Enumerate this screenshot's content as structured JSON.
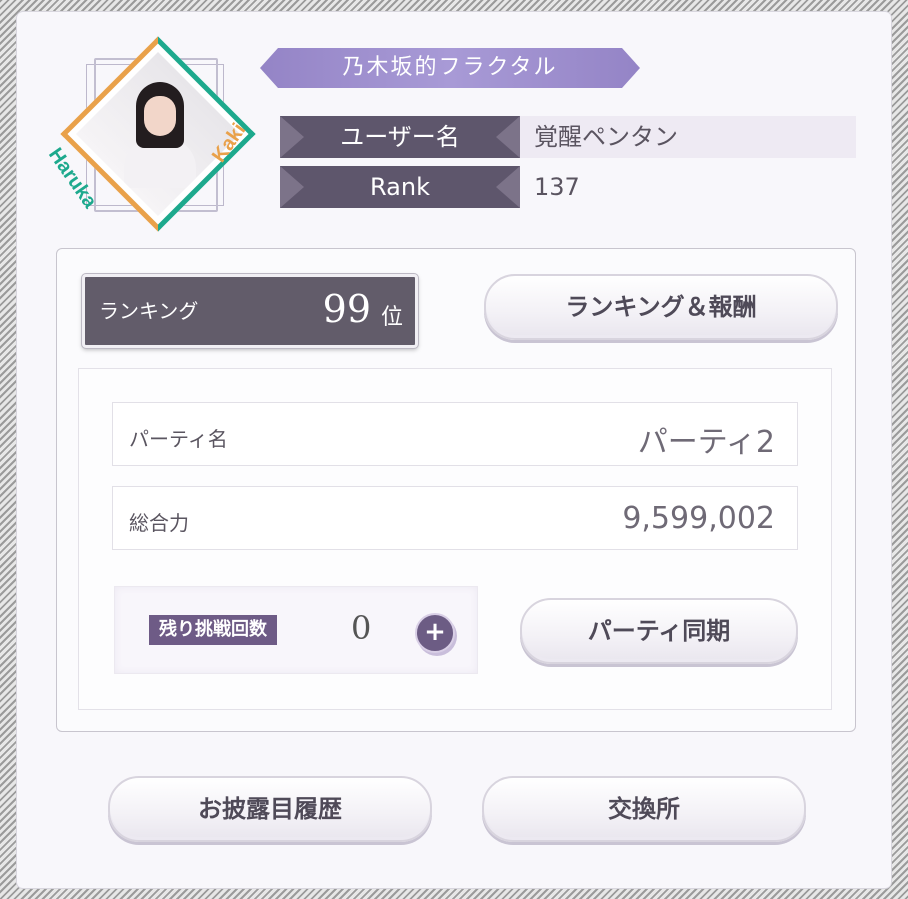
{
  "title_banner": "乃木坂的フラクタル",
  "portrait": {
    "name_first": "Haruka",
    "name_last": "Kaki",
    "colors": {
      "first": "#1da98d",
      "last": "#e9a14a"
    }
  },
  "profile": {
    "username_label": "ユーザー名",
    "username_value": "覚醒ペンタン",
    "rank_label": "Rank",
    "rank_value": "137"
  },
  "ranking": {
    "label": "ランキング",
    "position": "99",
    "unit": "位",
    "button": "ランキング＆報酬"
  },
  "party": {
    "name_label": "パーティ名",
    "name_value": "パーティ2",
    "power_label": "総合力",
    "power_value": "9,599,002",
    "challenge_label": "残り挑戦回数",
    "challenge_count": "0",
    "plus_icon": "plus-icon",
    "sync_button": "パーティ同期"
  },
  "footer": {
    "history_button": "お披露目履歴",
    "exchange_button": "交換所"
  },
  "colors": {
    "accent": "#9484c6",
    "label_bg": "#5e566c",
    "tag_bg": "#6e5b86"
  }
}
